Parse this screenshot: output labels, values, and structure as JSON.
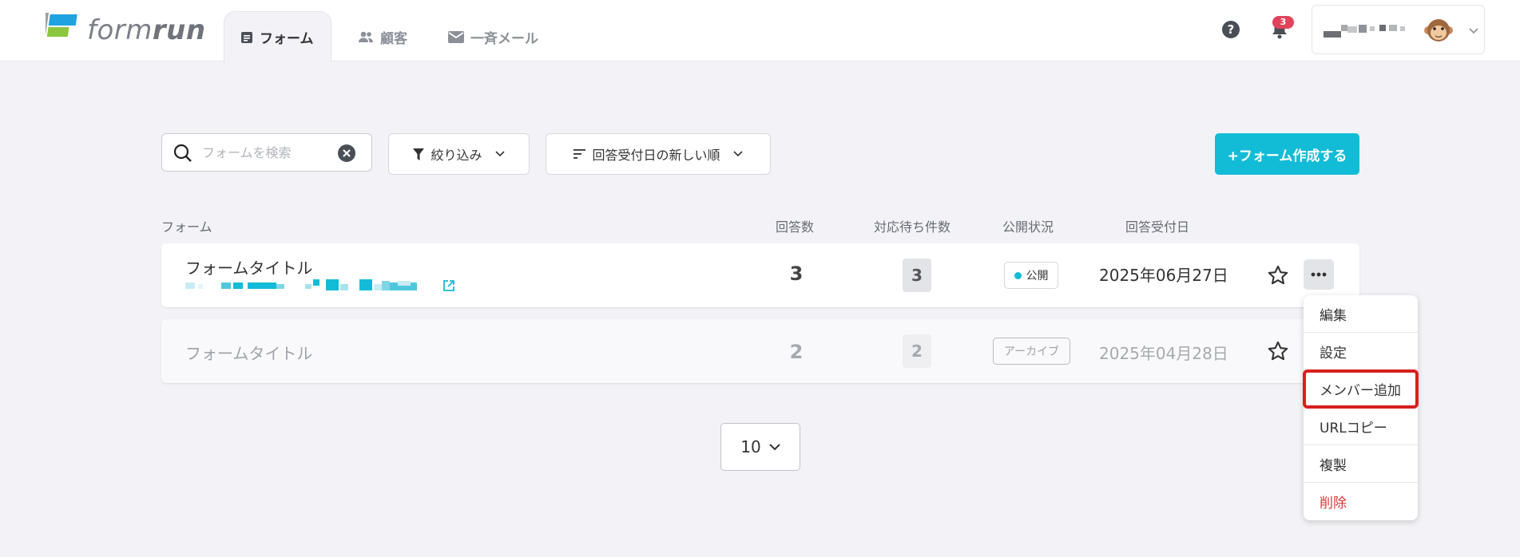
{
  "header": {
    "logo_text_light": "form",
    "logo_text_bold": "run",
    "tabs": [
      {
        "label": "フォーム",
        "icon": "form-icon",
        "active": true
      },
      {
        "label": "顧客",
        "icon": "people-icon",
        "active": false
      },
      {
        "label": "一斉メール",
        "icon": "mail-icon",
        "active": false
      }
    ],
    "notification_count": "3",
    "help_icon": "question-circle-icon",
    "bell_icon": "bell-icon",
    "avatar_icon": "monkey-avatar-icon"
  },
  "toolbar": {
    "search_placeholder": "フォームを検索",
    "search_value": "",
    "filter_label": "絞り込み",
    "sort_label": "回答受付日の新しい順",
    "create_label": "+フォーム作成する"
  },
  "table": {
    "headers": {
      "form": "フォーム",
      "responses": "回答数",
      "pending": "対応待ち件数",
      "status": "公開状況",
      "date": "回答受付日"
    },
    "rows": [
      {
        "title": "フォームタイトル",
        "responses": "3",
        "pending": "3",
        "status": "公開",
        "date": "2025年06月27日",
        "archived": false
      },
      {
        "title": "フォームタイトル",
        "responses": "2",
        "pending": "2",
        "status": "アーカイブ",
        "date": "2025年04月28日",
        "archived": true
      }
    ]
  },
  "menu": {
    "items": [
      {
        "label": "編集"
      },
      {
        "label": "設定"
      },
      {
        "label": "メンバー追加",
        "highlighted": true
      },
      {
        "label": "URLコピー"
      },
      {
        "label": "複製"
      },
      {
        "label": "削除",
        "danger": true
      }
    ]
  },
  "pager": {
    "per_page": "10"
  },
  "colors": {
    "accent": "#13bcd6",
    "danger": "#d83a3a",
    "badge": "#e0435b",
    "highlight": "#d81f1f"
  }
}
